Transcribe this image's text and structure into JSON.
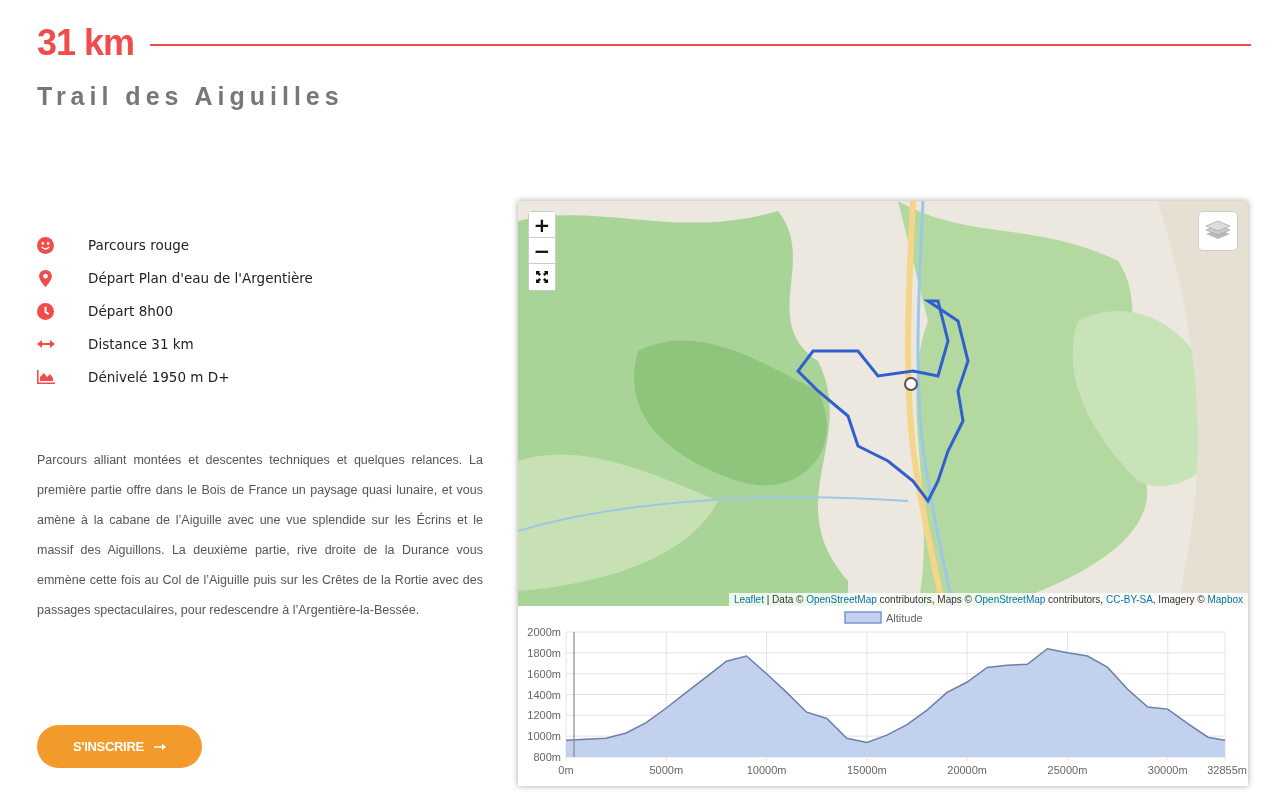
{
  "header": {
    "distance": "31 km",
    "title": "Trail des Aiguilles"
  },
  "facts": [
    {
      "label": "Parcours rouge"
    },
    {
      "label": "Départ Plan d'eau de l'Argentière"
    },
    {
      "label": "Départ 8h00"
    },
    {
      "label": "Distance 31 km"
    },
    {
      "label": "Dénivelé 1950 m D+"
    }
  ],
  "description": "Parcours alliant montées et descentes techniques et quelques relances. La première partie offre dans le Bois de France un paysage quasi lunaire, et vous amène à la cabane de l’Aiguille avec une vue splendide sur les Écrins et le massif des Aiguillons. La deuxième partie, rive droite de la Durance vous emmène cette fois au Col de l’Aiguille puis sur les Crêtes de la Rortie avec des passages spectaculaires, pour redescendre à l’Argentière-la-Bessée.",
  "register_button": "S'INSCRIRE",
  "map": {
    "kind": "picture",
    "zoom_in": "+",
    "zoom_out": "−",
    "attribution": [
      {
        "text": "Leaflet",
        "link": true
      },
      {
        "text": " | Data © ",
        "link": false
      },
      {
        "text": "OpenStreetMap",
        "link": true
      },
      {
        "text": " contributors, Maps © ",
        "link": false
      },
      {
        "text": "OpenStreetMap",
        "link": true
      },
      {
        "text": " contributors, ",
        "link": false
      },
      {
        "text": "CC-BY-SA",
        "link": true
      },
      {
        "text": ", Imagery © ",
        "link": false
      },
      {
        "text": "Mapbox",
        "link": true
      }
    ]
  },
  "elevation": {
    "chart_data": {
      "type": "area",
      "xlim": [
        0,
        32855
      ],
      "ylim": [
        800,
        2000
      ],
      "x": [
        0,
        1000,
        2000,
        3000,
        4000,
        5000,
        6000,
        7000,
        8000,
        9000,
        10000,
        11000,
        12000,
        13000,
        14000,
        15000,
        16000,
        17000,
        18000,
        19000,
        20000,
        21000,
        22000,
        23000,
        24000,
        25000,
        26000,
        27000,
        28000,
        29000,
        30000,
        31000,
        32000,
        32855
      ],
      "series": [
        {
          "name": "Altitude",
          "color": "#c2d1ee",
          "values": [
            960,
            970,
            980,
            1030,
            1130,
            1270,
            1420,
            1570,
            1720,
            1770,
            1600,
            1420,
            1230,
            1170,
            980,
            940,
            1010,
            1110,
            1250,
            1420,
            1520,
            1660,
            1680,
            1690,
            1840,
            1800,
            1770,
            1660,
            1450,
            1280,
            1260,
            1120,
            990,
            960
          ]
        }
      ],
      "grid": true,
      "ref_lines": [
        {
          "axis": "x",
          "value": 400
        }
      ],
      "xticks": [
        {
          "value": 0,
          "label": "0m"
        },
        {
          "value": 5000,
          "label": "5000m"
        },
        {
          "value": 10000,
          "label": "10000m"
        },
        {
          "value": 15000,
          "label": "15000m"
        },
        {
          "value": 20000,
          "label": "20000m"
        },
        {
          "value": 25000,
          "label": "25000m"
        },
        {
          "value": 30000,
          "label": "30000m"
        },
        {
          "value": 32855,
          "label": "32855m"
        }
      ],
      "yticks": [
        {
          "value": 800,
          "label": "800m"
        },
        {
          "value": 1000,
          "label": "1000m"
        },
        {
          "value": 1200,
          "label": "1200m"
        },
        {
          "value": 1400,
          "label": "1400m"
        },
        {
          "value": 1600,
          "label": "1600m"
        },
        {
          "value": 1800,
          "label": "1800m"
        },
        {
          "value": 2000,
          "label": "2000m"
        }
      ]
    }
  }
}
